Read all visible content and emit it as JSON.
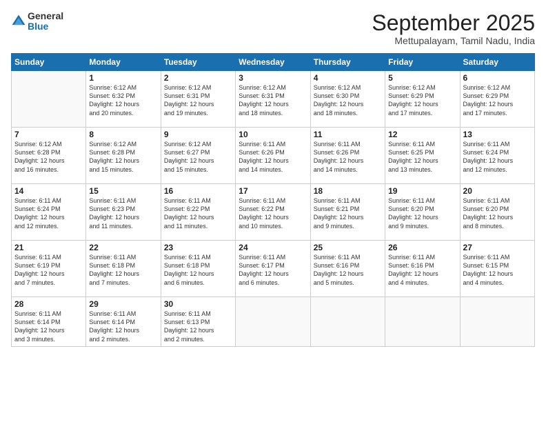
{
  "logo": {
    "general": "General",
    "blue": "Blue"
  },
  "title": "September 2025",
  "location": "Mettupalayam, Tamil Nadu, India",
  "headers": [
    "Sunday",
    "Monday",
    "Tuesday",
    "Wednesday",
    "Thursday",
    "Friday",
    "Saturday"
  ],
  "weeks": [
    [
      {
        "day": "",
        "info": ""
      },
      {
        "day": "1",
        "info": "Sunrise: 6:12 AM\nSunset: 6:32 PM\nDaylight: 12 hours\nand 20 minutes."
      },
      {
        "day": "2",
        "info": "Sunrise: 6:12 AM\nSunset: 6:31 PM\nDaylight: 12 hours\nand 19 minutes."
      },
      {
        "day": "3",
        "info": "Sunrise: 6:12 AM\nSunset: 6:31 PM\nDaylight: 12 hours\nand 18 minutes."
      },
      {
        "day": "4",
        "info": "Sunrise: 6:12 AM\nSunset: 6:30 PM\nDaylight: 12 hours\nand 18 minutes."
      },
      {
        "day": "5",
        "info": "Sunrise: 6:12 AM\nSunset: 6:29 PM\nDaylight: 12 hours\nand 17 minutes."
      },
      {
        "day": "6",
        "info": "Sunrise: 6:12 AM\nSunset: 6:29 PM\nDaylight: 12 hours\nand 17 minutes."
      }
    ],
    [
      {
        "day": "7",
        "info": "Sunrise: 6:12 AM\nSunset: 6:28 PM\nDaylight: 12 hours\nand 16 minutes."
      },
      {
        "day": "8",
        "info": "Sunrise: 6:12 AM\nSunset: 6:28 PM\nDaylight: 12 hours\nand 15 minutes."
      },
      {
        "day": "9",
        "info": "Sunrise: 6:12 AM\nSunset: 6:27 PM\nDaylight: 12 hours\nand 15 minutes."
      },
      {
        "day": "10",
        "info": "Sunrise: 6:11 AM\nSunset: 6:26 PM\nDaylight: 12 hours\nand 14 minutes."
      },
      {
        "day": "11",
        "info": "Sunrise: 6:11 AM\nSunset: 6:26 PM\nDaylight: 12 hours\nand 14 minutes."
      },
      {
        "day": "12",
        "info": "Sunrise: 6:11 AM\nSunset: 6:25 PM\nDaylight: 12 hours\nand 13 minutes."
      },
      {
        "day": "13",
        "info": "Sunrise: 6:11 AM\nSunset: 6:24 PM\nDaylight: 12 hours\nand 12 minutes."
      }
    ],
    [
      {
        "day": "14",
        "info": "Sunrise: 6:11 AM\nSunset: 6:24 PM\nDaylight: 12 hours\nand 12 minutes."
      },
      {
        "day": "15",
        "info": "Sunrise: 6:11 AM\nSunset: 6:23 PM\nDaylight: 12 hours\nand 11 minutes."
      },
      {
        "day": "16",
        "info": "Sunrise: 6:11 AM\nSunset: 6:22 PM\nDaylight: 12 hours\nand 11 minutes."
      },
      {
        "day": "17",
        "info": "Sunrise: 6:11 AM\nSunset: 6:22 PM\nDaylight: 12 hours\nand 10 minutes."
      },
      {
        "day": "18",
        "info": "Sunrise: 6:11 AM\nSunset: 6:21 PM\nDaylight: 12 hours\nand 9 minutes."
      },
      {
        "day": "19",
        "info": "Sunrise: 6:11 AM\nSunset: 6:20 PM\nDaylight: 12 hours\nand 9 minutes."
      },
      {
        "day": "20",
        "info": "Sunrise: 6:11 AM\nSunset: 6:20 PM\nDaylight: 12 hours\nand 8 minutes."
      }
    ],
    [
      {
        "day": "21",
        "info": "Sunrise: 6:11 AM\nSunset: 6:19 PM\nDaylight: 12 hours\nand 7 minutes."
      },
      {
        "day": "22",
        "info": "Sunrise: 6:11 AM\nSunset: 6:18 PM\nDaylight: 12 hours\nand 7 minutes."
      },
      {
        "day": "23",
        "info": "Sunrise: 6:11 AM\nSunset: 6:18 PM\nDaylight: 12 hours\nand 6 minutes."
      },
      {
        "day": "24",
        "info": "Sunrise: 6:11 AM\nSunset: 6:17 PM\nDaylight: 12 hours\nand 6 minutes."
      },
      {
        "day": "25",
        "info": "Sunrise: 6:11 AM\nSunset: 6:16 PM\nDaylight: 12 hours\nand 5 minutes."
      },
      {
        "day": "26",
        "info": "Sunrise: 6:11 AM\nSunset: 6:16 PM\nDaylight: 12 hours\nand 4 minutes."
      },
      {
        "day": "27",
        "info": "Sunrise: 6:11 AM\nSunset: 6:15 PM\nDaylight: 12 hours\nand 4 minutes."
      }
    ],
    [
      {
        "day": "28",
        "info": "Sunrise: 6:11 AM\nSunset: 6:14 PM\nDaylight: 12 hours\nand 3 minutes."
      },
      {
        "day": "29",
        "info": "Sunrise: 6:11 AM\nSunset: 6:14 PM\nDaylight: 12 hours\nand 2 minutes."
      },
      {
        "day": "30",
        "info": "Sunrise: 6:11 AM\nSunset: 6:13 PM\nDaylight: 12 hours\nand 2 minutes."
      },
      {
        "day": "",
        "info": ""
      },
      {
        "day": "",
        "info": ""
      },
      {
        "day": "",
        "info": ""
      },
      {
        "day": "",
        "info": ""
      }
    ]
  ]
}
